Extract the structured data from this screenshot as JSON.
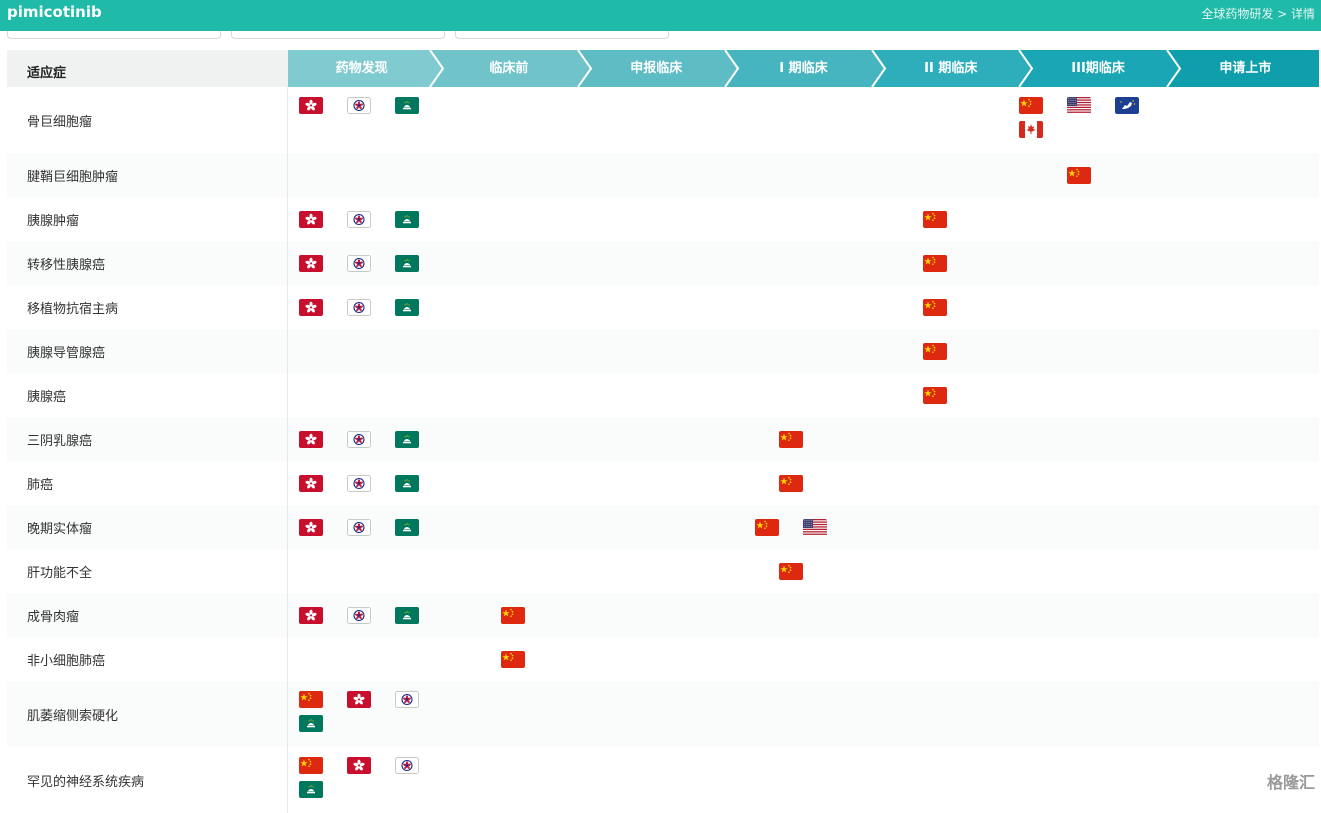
{
  "app": {
    "title": "pimicotinib",
    "breadcrumb": "全球药物研发 > 详情"
  },
  "table": {
    "indication_header": "适应症",
    "phases": [
      "药物发现",
      "临床前",
      "申报临床",
      "I 期临床",
      "II 期临床",
      "III期临床",
      "申请上市"
    ],
    "phase_colors": [
      "#7fcbd0",
      "#6fc3c9",
      "#5dbcc4",
      "#46b5c0",
      "#2eaebb",
      "#1aa6b4",
      "#0f9eac"
    ],
    "rows": [
      {
        "indication": "骨巨细胞瘤",
        "flags": [
          [
            "HK",
            0,
            0
          ],
          [
            "TW",
            1,
            0
          ],
          [
            "MO",
            2,
            0
          ],
          [
            "CN",
            15,
            0
          ],
          [
            "US",
            16,
            0
          ],
          [
            "EU",
            17,
            0
          ],
          [
            "CA",
            15,
            1
          ]
        ]
      },
      {
        "indication": "腱鞘巨细胞肿瘤",
        "flags": [
          [
            "CN",
            16,
            0
          ]
        ]
      },
      {
        "indication": "胰腺肿瘤",
        "flags": [
          [
            "HK",
            0,
            0
          ],
          [
            "TW",
            1,
            0
          ],
          [
            "MO",
            2,
            0
          ],
          [
            "CN",
            13,
            0
          ]
        ]
      },
      {
        "indication": "转移性胰腺癌",
        "flags": [
          [
            "HK",
            0,
            0
          ],
          [
            "TW",
            1,
            0
          ],
          [
            "MO",
            2,
            0
          ],
          [
            "CN",
            13,
            0
          ]
        ]
      },
      {
        "indication": "移植物抗宿主病",
        "flags": [
          [
            "HK",
            0,
            0
          ],
          [
            "TW",
            1,
            0
          ],
          [
            "MO",
            2,
            0
          ],
          [
            "CN",
            13,
            0
          ]
        ]
      },
      {
        "indication": "胰腺导管腺癌",
        "flags": [
          [
            "CN",
            13,
            0
          ]
        ]
      },
      {
        "indication": "胰腺癌",
        "flags": [
          [
            "CN",
            13,
            0
          ]
        ]
      },
      {
        "indication": "三阴乳腺癌",
        "flags": [
          [
            "HK",
            0,
            0
          ],
          [
            "TW",
            1,
            0
          ],
          [
            "MO",
            2,
            0
          ],
          [
            "CN",
            10,
            0
          ]
        ]
      },
      {
        "indication": "肺癌",
        "flags": [
          [
            "HK",
            0,
            0
          ],
          [
            "TW",
            1,
            0
          ],
          [
            "MO",
            2,
            0
          ],
          [
            "CN",
            10,
            0
          ]
        ]
      },
      {
        "indication": "晚期实体瘤",
        "flags": [
          [
            "HK",
            0,
            0
          ],
          [
            "TW",
            1,
            0
          ],
          [
            "MO",
            2,
            0
          ],
          [
            "CN",
            9.5,
            0
          ],
          [
            "US",
            10.5,
            0
          ]
        ]
      },
      {
        "indication": "肝功能不全",
        "flags": [
          [
            "CN",
            10,
            0
          ]
        ]
      },
      {
        "indication": "成骨肉瘤",
        "flags": [
          [
            "HK",
            0,
            0
          ],
          [
            "TW",
            1,
            0
          ],
          [
            "MO",
            2,
            0
          ],
          [
            "CN",
            4.2,
            0
          ]
        ]
      },
      {
        "indication": "非小细胞肺癌",
        "flags": [
          [
            "CN",
            4.2,
            0
          ]
        ]
      },
      {
        "indication": "肌萎缩侧索硬化",
        "flags": [
          [
            "CN",
            0,
            0
          ],
          [
            "HK",
            1,
            0
          ],
          [
            "TW",
            2,
            0
          ],
          [
            "MO",
            0,
            1
          ]
        ]
      },
      {
        "indication": "罕见的神经系统疾病",
        "flags": [
          [
            "CN",
            0,
            0
          ],
          [
            "HK",
            1,
            0
          ],
          [
            "TW",
            2,
            0
          ],
          [
            "MO",
            0,
            1
          ]
        ]
      }
    ]
  },
  "flag_names": {
    "CN": "china-flag-icon",
    "HK": "hong-kong-flag-icon",
    "TW": "taiwan-flag-icon",
    "MO": "macau-flag-icon",
    "US": "usa-flag-icon",
    "EU": "europe-flag-icon",
    "CA": "canada-flag-icon"
  },
  "watermark": "格隆汇"
}
